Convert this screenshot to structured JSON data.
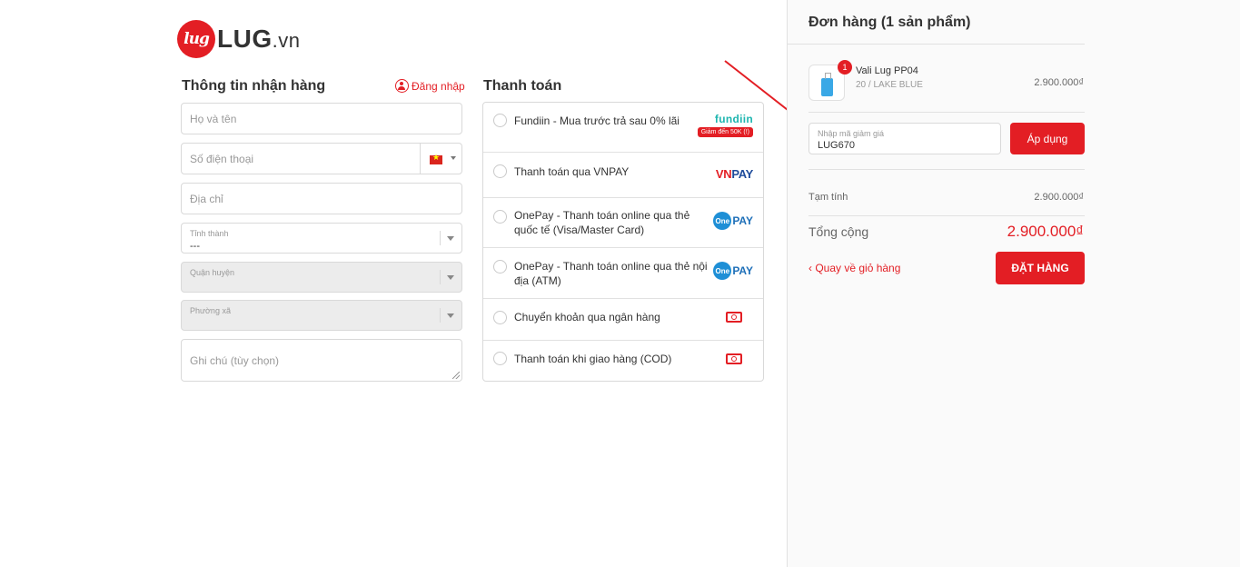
{
  "brand": {
    "logo_mark": "lug",
    "name": "LUG",
    "tld": ".vn"
  },
  "shipping": {
    "title": "Thông tin nhận hàng",
    "login_label": "Đăng nhập",
    "name_placeholder": "Họ và tên",
    "phone_placeholder": "Số điện thoại",
    "address_placeholder": "Địa chỉ",
    "province_label": "Tỉnh thành",
    "province_value": "---",
    "district_label": "Quận huyện",
    "ward_label": "Phường xã",
    "note_placeholder": "Ghi chú (tùy chọn)"
  },
  "payment": {
    "title": "Thanh toán",
    "methods": [
      {
        "label": "Fundiin - Mua trước trả sau 0% lãi",
        "logo": "fundiin",
        "badge": "Giảm đến 50K (!)"
      },
      {
        "label": "Thanh toán qua VNPAY",
        "logo": "VNPAY"
      },
      {
        "label": "OnePay - Thanh toán online qua thẻ quốc tế (Visa/Master Card)",
        "logo": "OnePAY"
      },
      {
        "label": "OnePay - Thanh toán online qua thẻ nội địa (ATM)",
        "logo": "OnePAY"
      },
      {
        "label": "Chuyển khoản qua ngân hàng",
        "logo": "cash-icon"
      },
      {
        "label": "Thanh toán khi giao hàng (COD)",
        "logo": "cash-icon"
      }
    ]
  },
  "order": {
    "title": "Đơn hàng (1 sản phẩm)",
    "item": {
      "name": "Vali Lug PP04",
      "variant": "20 / LAKE BLUE",
      "price": "2.900.000₫",
      "quantity": "1"
    },
    "coupon": {
      "label": "Nhập mã giảm giá",
      "value": "LUG670",
      "apply_label": "Áp dụng"
    },
    "subtotal_label": "Tạm tính",
    "subtotal_value": "2.900.000₫",
    "total_label": "Tổng cộng",
    "total_value": "2.900.000₫",
    "back_label": "‹ Quay về giỏ hàng",
    "place_order_label": "ĐẶT HÀNG"
  },
  "colors": {
    "accent": "#e31e24",
    "panel_bg": "#fafafa",
    "border": "#d9d9d9"
  }
}
